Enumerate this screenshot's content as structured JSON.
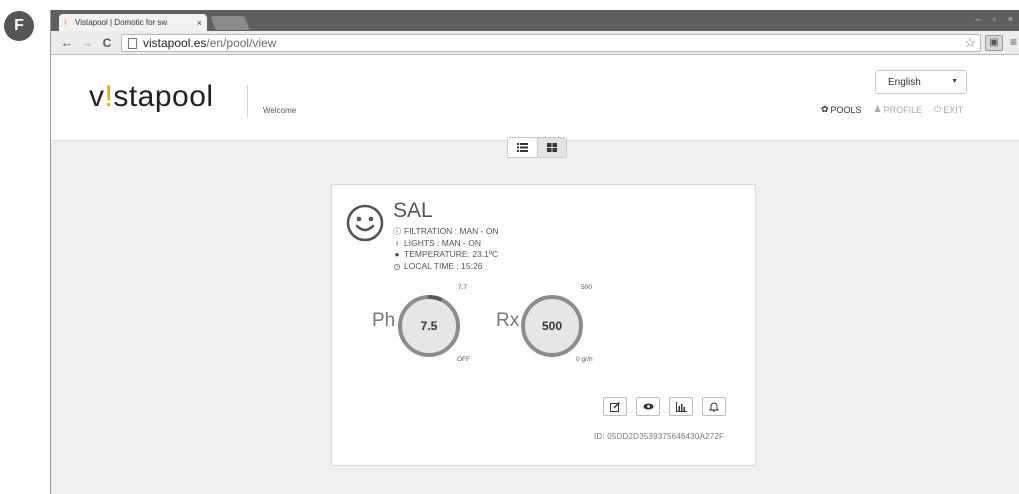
{
  "figure": {
    "marker": "F"
  },
  "browser": {
    "tab_title": "Vistapool | Domotic for sw",
    "tab_close": "×",
    "url_host": "vistapool.es",
    "url_path": "/en/pool/view",
    "window_controls": [
      "–",
      "▫",
      "×"
    ]
  },
  "header": {
    "logo_pre": "v",
    "logo_bang": "!",
    "logo_post": "stapool",
    "welcome": "Welcome",
    "language": "English",
    "nav": [
      {
        "label": "POOLS",
        "icon": "gear-icon"
      },
      {
        "label": "PROFILE",
        "icon": "person-icon"
      },
      {
        "label": "EXIT",
        "icon": "power-icon"
      }
    ]
  },
  "view_toggle": {
    "list_icon": "list-icon",
    "grid_icon": "grid-icon"
  },
  "pool": {
    "name": "SAL",
    "status_icon": "smiley-icon",
    "status": {
      "filtration": "FILTRATION : MAN - ON",
      "lights": "LIGHTS : MAN - ON",
      "temperature": "TEMPERATURE: 23.1ºC",
      "local_time": "LOCAL TIME : 15:26"
    },
    "ph": {
      "label": "Ph",
      "value": "7.5",
      "target": "7.7",
      "sub": "OFF"
    },
    "rx": {
      "label": "Rx",
      "value": "500",
      "target": "500",
      "sub": "0 gr/h"
    },
    "actions": [
      "edit-icon",
      "view-icon",
      "chart-icon",
      "bell-icon"
    ],
    "device_id": "ID: 05DD2D3539375646430A272F"
  },
  "colors": {
    "gauge_fill": "#e6e6e6",
    "gauge_ring": "#8c8c8c",
    "logo_accent": "#e0a800"
  }
}
